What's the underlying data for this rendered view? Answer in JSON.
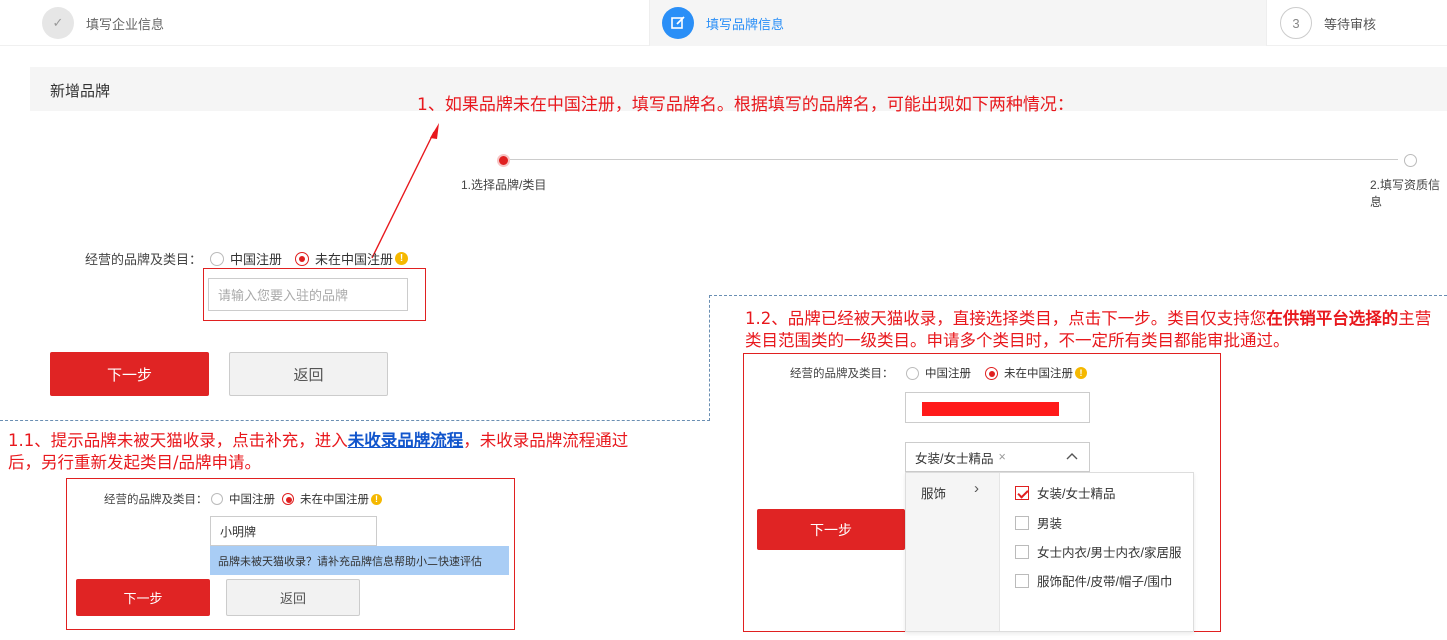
{
  "steps": [
    {
      "num": "✓",
      "label": "填写企业信息"
    },
    {
      "num": "✎",
      "label": "填写品牌信息"
    },
    {
      "num": "3",
      "label": "等待审核"
    }
  ],
  "section_title": "新增品牌",
  "annotations": {
    "a1": "1、如果品牌未在中国注册，填写品牌名。根据填写的品牌名，可能出现如下两种情况：",
    "a11_pre": "1.1、提示品牌未被天猫收录，点击补充，进入",
    "a11_link": "未收录品牌流程",
    "a11_post": "，未收录品牌流程通过后，另行重新发起类目/品牌申请。",
    "a12_pre": "1.2、品牌已经被天猫收录，直接选择类目，点击下一步。类目仅支持您",
    "a12_bold": "在供销平台选择的",
    "a12_post": "主营类目范围类的一级类目。申请多个类目时，不一定所有类目都能审批通过。"
  },
  "progress": {
    "step1": "1.选择品牌/类目",
    "step2": "2.填写资质信息"
  },
  "form": {
    "label": "经营的品牌及类目：",
    "radio_cn": "中国注册",
    "radio_not_cn": "未在中国注册",
    "warn": "!",
    "brand_placeholder": "请输入您要入驻的品牌",
    "next": "下一步",
    "back": "返回"
  },
  "example1": {
    "label": "经营的品牌及类目：",
    "radio_cn": "中国注册",
    "radio_not_cn": "未在中国注册",
    "brand_value": "小明牌",
    "tip": "品牌未被天猫收录？请补充品牌信息帮助小二快速评估",
    "next": "下一步",
    "back": "返回"
  },
  "example2": {
    "label": "经营的品牌及类目：",
    "radio_cn": "中国注册",
    "radio_not_cn": "未在中国注册",
    "selected_tag": "女装/女士精品",
    "tag_close": "×",
    "next": "下一步",
    "category_left": "服饰",
    "category_arrow": "›",
    "options": [
      {
        "label": "女装/女士精品",
        "checked": true
      },
      {
        "label": "男装",
        "checked": false
      },
      {
        "label": "女士内衣/男士内衣/家居服",
        "checked": false
      },
      {
        "label": "服饰配件/皮带/帽子/围巾",
        "checked": false
      }
    ]
  },
  "colors": {
    "accent_red": "#e02424",
    "step_blue": "#2a8ff7",
    "annotation_red": "#e8181d"
  }
}
